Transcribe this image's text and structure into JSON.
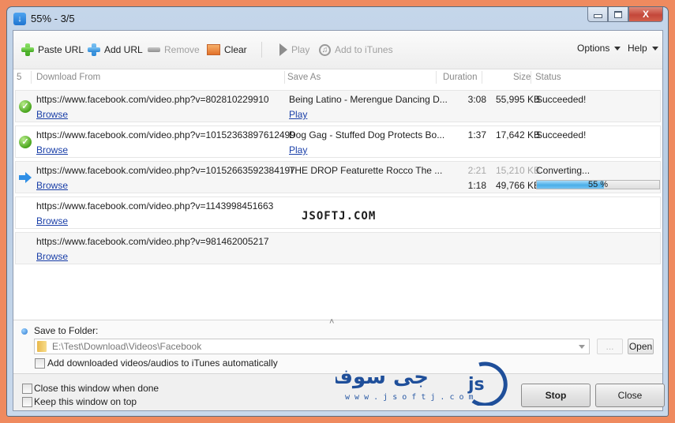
{
  "window": {
    "title": "55% - 3/5",
    "app_icon": "download-arrow-icon",
    "caption": {
      "minimize": "minimize-icon",
      "maximize": "maximize-icon",
      "close": "close-icon",
      "close_glyph": "X"
    }
  },
  "toolbar": {
    "paste_url": "Paste URL",
    "add_url": "Add URL",
    "remove": "Remove",
    "clear": "Clear",
    "play": "Play",
    "add_to_itunes": "Add to iTunes",
    "options": "Options",
    "help": "Help"
  },
  "table": {
    "count": "5",
    "columns": {
      "download_from": "Download From",
      "save_as": "Save As",
      "duration": "Duration",
      "size": "Size",
      "status": "Status"
    },
    "rows": [
      {
        "icon": "success-check-icon",
        "url": "https://www.facebook.com/video.php?v=802810229910",
        "browse": "Browse",
        "save_as": "Being Latino - Merengue Dancing D...",
        "play": "Play",
        "duration": "3:08",
        "size": "55,995 KB",
        "status": "Succeeded!"
      },
      {
        "icon": "success-check-icon",
        "url": "https://www.facebook.com/video.php?v=10152363897612499",
        "browse": "Browse",
        "save_as": "Dog Gag - Stuffed Dog Protects Bo...",
        "play": "Play",
        "duration": "1:37",
        "size": "17,642 KB",
        "status": "Succeeded!"
      },
      {
        "icon": "converting-arrow-icon",
        "url": "https://www.facebook.com/video.php?v=10152663592384197",
        "browse": "Browse",
        "save_as": "THE DROP Featurette   Rocco The ...",
        "duration": "2:21",
        "duration_2": "1:18",
        "size": "15,210 KB",
        "size_2": "49,766 KB",
        "status": "Converting...",
        "progress_percent": 55,
        "progress_label": "55 %"
      },
      {
        "url": "https://www.facebook.com/video.php?v=1143998451663",
        "browse": "Browse"
      },
      {
        "url": "https://www.facebook.com/video.php?v=981462005217",
        "browse": "Browse"
      }
    ]
  },
  "watermark": "JSOFTJ.COM",
  "save_folder": {
    "label": "Save to Folder:",
    "path": "E:\\Test\\Download\\Videos\\Facebook",
    "browse_button": "...",
    "open_button": "Open",
    "itunes_checkbox_label": "Add downloaded videos/audios to iTunes automatically",
    "itunes_checked": false
  },
  "footer": {
    "close_when_done": "Close this window when done",
    "close_when_done_checked": false,
    "keep_on_top": "Keep this window on top",
    "keep_on_top_checked": false,
    "stop": "Stop",
    "close": "Close"
  },
  "logo": {
    "arabic": "جی سوفت",
    "url": "w w w . j s o f t j . c o m",
    "mark": "js"
  },
  "colors": {
    "accent": "#2f8fe6",
    "progress": "#4aaee8",
    "success": "#4aa51e",
    "link": "#1a3fa8",
    "frame": "#ef8a5f"
  }
}
